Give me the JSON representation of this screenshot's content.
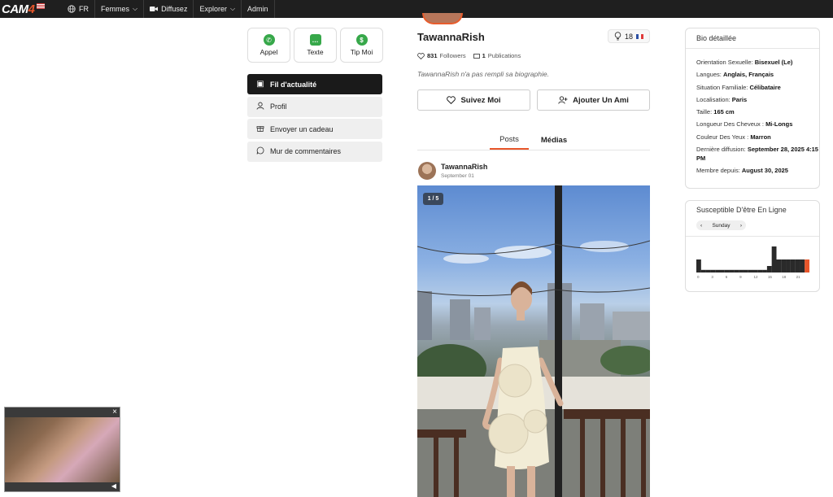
{
  "nav": {
    "logo_main": "CAM",
    "logo_num": "4",
    "lang": "FR",
    "items": [
      {
        "label": "Femmes",
        "icon": "chevron-down-icon"
      },
      {
        "label": "Diffusez",
        "icon": "camera-icon"
      },
      {
        "label": "Explorer",
        "icon": "chevron-down-icon"
      },
      {
        "label": "Admin"
      }
    ]
  },
  "actions": [
    {
      "label": "Appel",
      "icon": "phone-icon"
    },
    {
      "label": "Texte",
      "icon": "message-icon"
    },
    {
      "label": "Tip Moi",
      "icon": "dollar-icon"
    }
  ],
  "menu": [
    {
      "label": "Fil d'actualité",
      "icon": "feed-icon",
      "active": true
    },
    {
      "label": "Profil",
      "icon": "user-icon"
    },
    {
      "label": "Envoyer un cadeau",
      "icon": "gift-icon"
    },
    {
      "label": "Mur de commentaires",
      "icon": "comment-icon"
    }
  ],
  "profile": {
    "username": "TawannaRish",
    "viewers": "18",
    "followers_count": "831",
    "followers_label": "Followers",
    "publications_count": "1",
    "publications_label": "Publications",
    "bio_empty": "TawannaRish n'a pas rempli sa biographie.",
    "follow_label": "Suivez Moi",
    "add_friend_label": "Ajouter Un Ami"
  },
  "tabs": [
    {
      "label": "Posts",
      "active": true
    },
    {
      "label": "Médias",
      "active": false
    }
  ],
  "post": {
    "author": "TawannaRish",
    "date": "September 01",
    "counter": "1 / 5"
  },
  "bio": {
    "title": "Bio détaillée",
    "rows": [
      {
        "key": "Orientation Sexuelle:",
        "value": "Bisexuel (Le)"
      },
      {
        "key": "Langues:",
        "value": "Anglais, Français"
      },
      {
        "key": "Situation Familiale:",
        "value": "Célibataire"
      },
      {
        "key": "Localisation:",
        "value": "Paris"
      },
      {
        "key": "Taille:",
        "value": "165 cm"
      },
      {
        "key": "Longueur Des Cheveux :",
        "value": "Mi-Longs"
      },
      {
        "key": "Couleur Des Yeux :",
        "value": "Marron"
      },
      {
        "key": "Dernière diffusion:",
        "value": "September 28, 2025 4:15 PM"
      },
      {
        "key": "Membre depuis:",
        "value": "August 30, 2025"
      }
    ]
  },
  "online": {
    "title": "Susceptible D'être En Ligne",
    "day": "Sunday"
  },
  "chart_data": {
    "type": "bar",
    "title": "Susceptible D'être En Ligne",
    "ticks": [
      "0",
      "3",
      "6",
      "9",
      "12",
      "15",
      "18",
      "21"
    ],
    "x": [
      0,
      1,
      2,
      3,
      4,
      5,
      6,
      7,
      8,
      9,
      10,
      11,
      12,
      13,
      14,
      15,
      16,
      17,
      18,
      19,
      20,
      21,
      22,
      23
    ],
    "values": [
      0.5,
      0.1,
      0.1,
      0.1,
      0.1,
      0.1,
      0.1,
      0.1,
      0.1,
      0.1,
      0.1,
      0.1,
      0.1,
      0.1,
      0.1,
      0.25,
      1.0,
      0.5,
      0.5,
      0.5,
      0.5,
      0.5,
      0.5,
      0.5
    ],
    "highlight_index": 23,
    "colors": {
      "bar": "#2a2a2a",
      "highlight": "#e8562a"
    },
    "ylim": [
      0,
      1
    ]
  },
  "mini_player": {
    "close": "×"
  }
}
